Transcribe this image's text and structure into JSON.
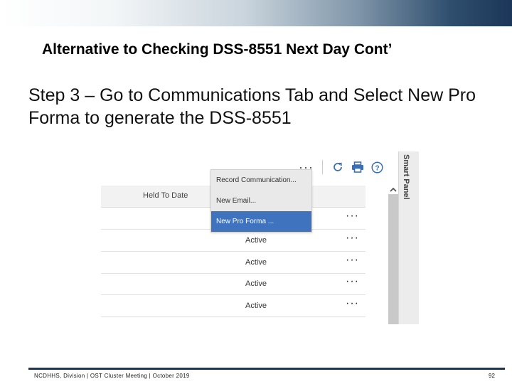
{
  "slide": {
    "title": "Alternative to Checking DSS-8551 Next Day Cont’",
    "body": "Step 3 – Go to Communications Tab and Select New Pro Forma to generate the DSS-8551"
  },
  "toolbar": {
    "more_label": "···",
    "icons": [
      "refresh-icon",
      "print-icon",
      "help-icon"
    ]
  },
  "table": {
    "column_header": "Held To Date",
    "rows": [
      {
        "status": "",
        "more": "···"
      },
      {
        "status": "Active",
        "more": "···"
      },
      {
        "status": "Active",
        "more": "···"
      },
      {
        "status": "Active",
        "more": "···"
      },
      {
        "status": "Active",
        "more": "···"
      }
    ]
  },
  "dropdown": {
    "items": [
      {
        "label": "Record Communication..."
      },
      {
        "label": "New Email..."
      },
      {
        "label": "New Pro Forma ...",
        "selected": true
      }
    ]
  },
  "smart_panel": {
    "label": "Smart Panel"
  },
  "footer": {
    "text": "NCDHHS, Division | OST Cluster Meeting | October 2019",
    "page_number": "92"
  },
  "colors": {
    "selected_item": "#3f73bd",
    "footer_line": "#1b3658"
  }
}
